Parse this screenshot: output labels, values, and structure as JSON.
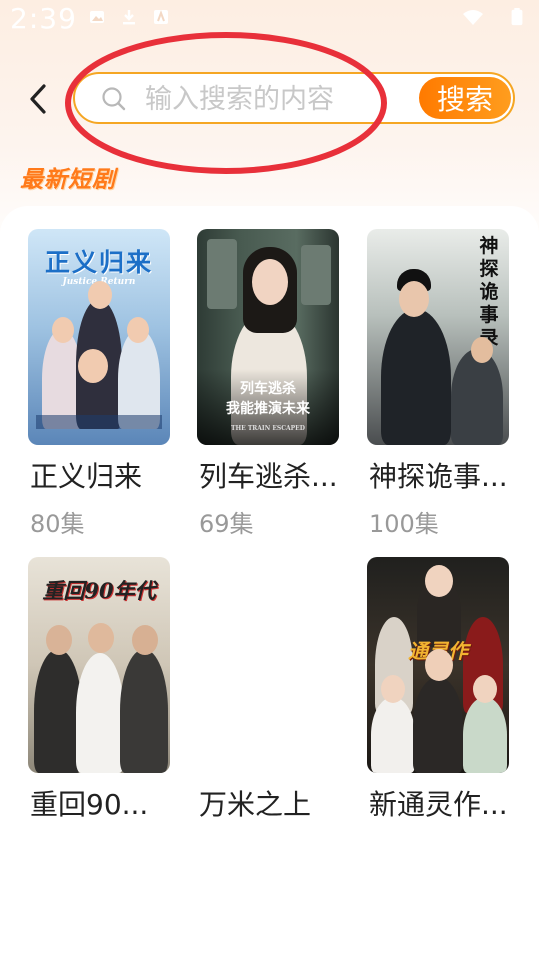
{
  "status_bar": {
    "time": "2:39"
  },
  "search": {
    "placeholder": "输入搜索的内容",
    "button_label": "搜索"
  },
  "section": {
    "title": "最新短剧"
  },
  "dramas": [
    {
      "title": "正义归来",
      "episodes": "80集",
      "poster_title": "正义归来",
      "poster_subtitle": "Justice Return"
    },
    {
      "title": "列车逃杀...",
      "episodes": "69集",
      "poster_title": "列车逃杀\n我能推演未来",
      "poster_subtitle": "THE TRAIN ESCAPED"
    },
    {
      "title": "神探诡事...",
      "episodes": "100集",
      "poster_title": "神探诡事录"
    },
    {
      "title": "重回90...",
      "episodes": "",
      "poster_title": "重回90年代"
    },
    {
      "title": "万米之上",
      "episodes": ""
    },
    {
      "title": "新通灵作...",
      "episodes": "",
      "poster_title": "通灵作"
    }
  ],
  "colors": {
    "accent": "#ff7a00",
    "annotation": "#e8303a"
  }
}
